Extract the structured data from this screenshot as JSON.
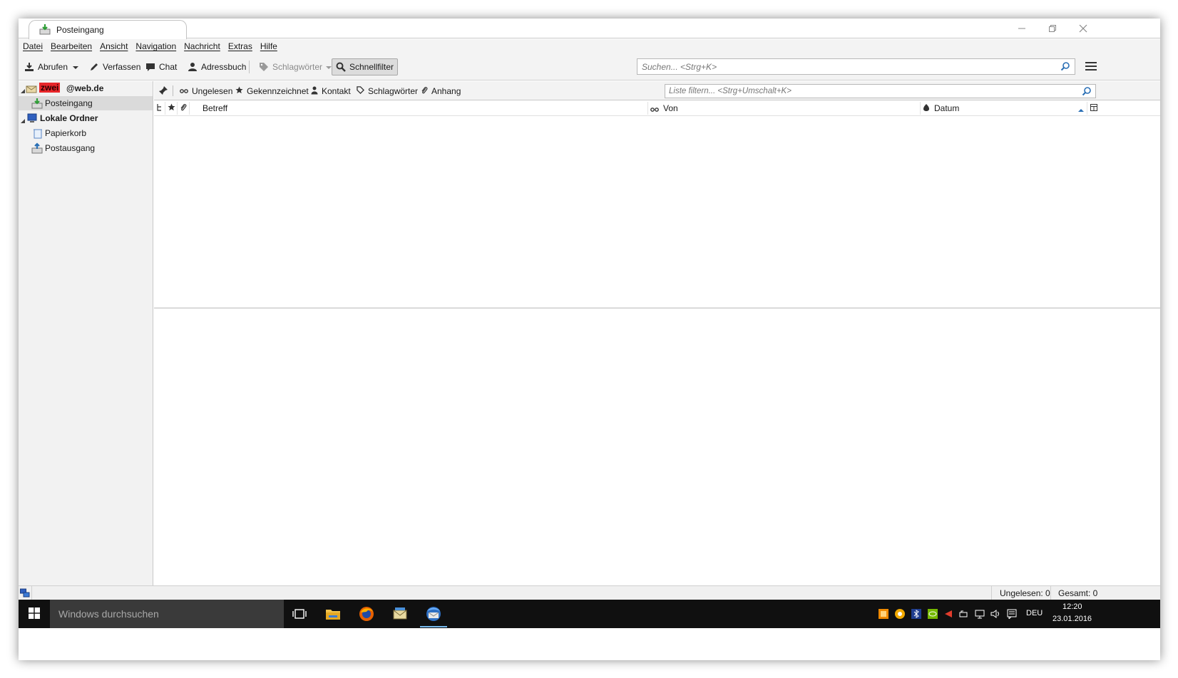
{
  "tab": {
    "title": "Posteingang"
  },
  "menu": [
    "Datei",
    "Bearbeiten",
    "Ansicht",
    "Navigation",
    "Nachricht",
    "Extras",
    "Hilfe"
  ],
  "toolbar": {
    "get_mail": "Abrufen",
    "write": "Verfassen",
    "chat": "Chat",
    "address_book": "Adressbuch",
    "tags": "Schlagwörter",
    "quick_filter": "Schnellfilter",
    "search_placeholder": "Suchen... <Strg+K>"
  },
  "folders": {
    "account_redacted": "zwei",
    "account_domain": "@web.de",
    "inbox": "Posteingang",
    "local_folders": "Lokale Ordner",
    "trash": "Papierkorb",
    "outbox": "Postausgang"
  },
  "quickfilter": {
    "unread": "Ungelesen",
    "starred": "Gekennzeichnet",
    "contact": "Kontakt",
    "tags": "Schlagwörter",
    "attachment": "Anhang",
    "filter_placeholder": "Liste filtern... <Strg+Umschalt+K>"
  },
  "columns": {
    "subject": "Betreff",
    "from": "Von",
    "date": "Datum"
  },
  "status": {
    "unread": "Ungelesen: 0",
    "total": "Gesamt: 0"
  },
  "taskbar": {
    "search_placeholder": "Windows durchsuchen",
    "language": "DEU",
    "time": "12:20",
    "date": "23.01.2016"
  },
  "colors": {
    "accent_red": "#e8262a",
    "taskbar_bg": "#101010",
    "active_underline": "#76b9ed"
  }
}
